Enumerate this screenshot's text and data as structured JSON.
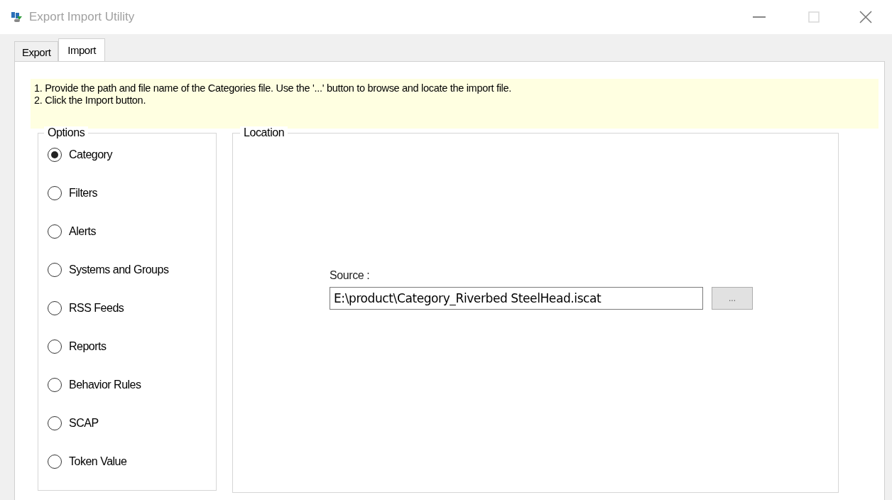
{
  "window": {
    "title": "Export Import Utility",
    "maximize_disabled": true
  },
  "tabs": [
    {
      "label": "Export",
      "selected": false
    },
    {
      "label": "Import",
      "selected": true
    }
  ],
  "instructions": [
    "1. Provide the path and file name of the Categories file. Use the '...' button to browse and locate the import file.",
    "2. Click the Import button."
  ],
  "options": {
    "title": "Options",
    "items": [
      {
        "label": "Category",
        "selected": true
      },
      {
        "label": "Filters",
        "selected": false
      },
      {
        "label": "Alerts",
        "selected": false
      },
      {
        "label": "Systems and Groups",
        "selected": false
      },
      {
        "label": "RSS Feeds",
        "selected": false
      },
      {
        "label": "Reports",
        "selected": false
      },
      {
        "label": "Behavior Rules",
        "selected": false
      },
      {
        "label": "SCAP",
        "selected": false
      },
      {
        "label": "Token Value",
        "selected": false
      }
    ]
  },
  "location": {
    "title": "Location",
    "source_label": "Source :",
    "source_value": "E:\\product\\Category_Riverbed SteelHead.iscat",
    "browse_label": "..."
  }
}
